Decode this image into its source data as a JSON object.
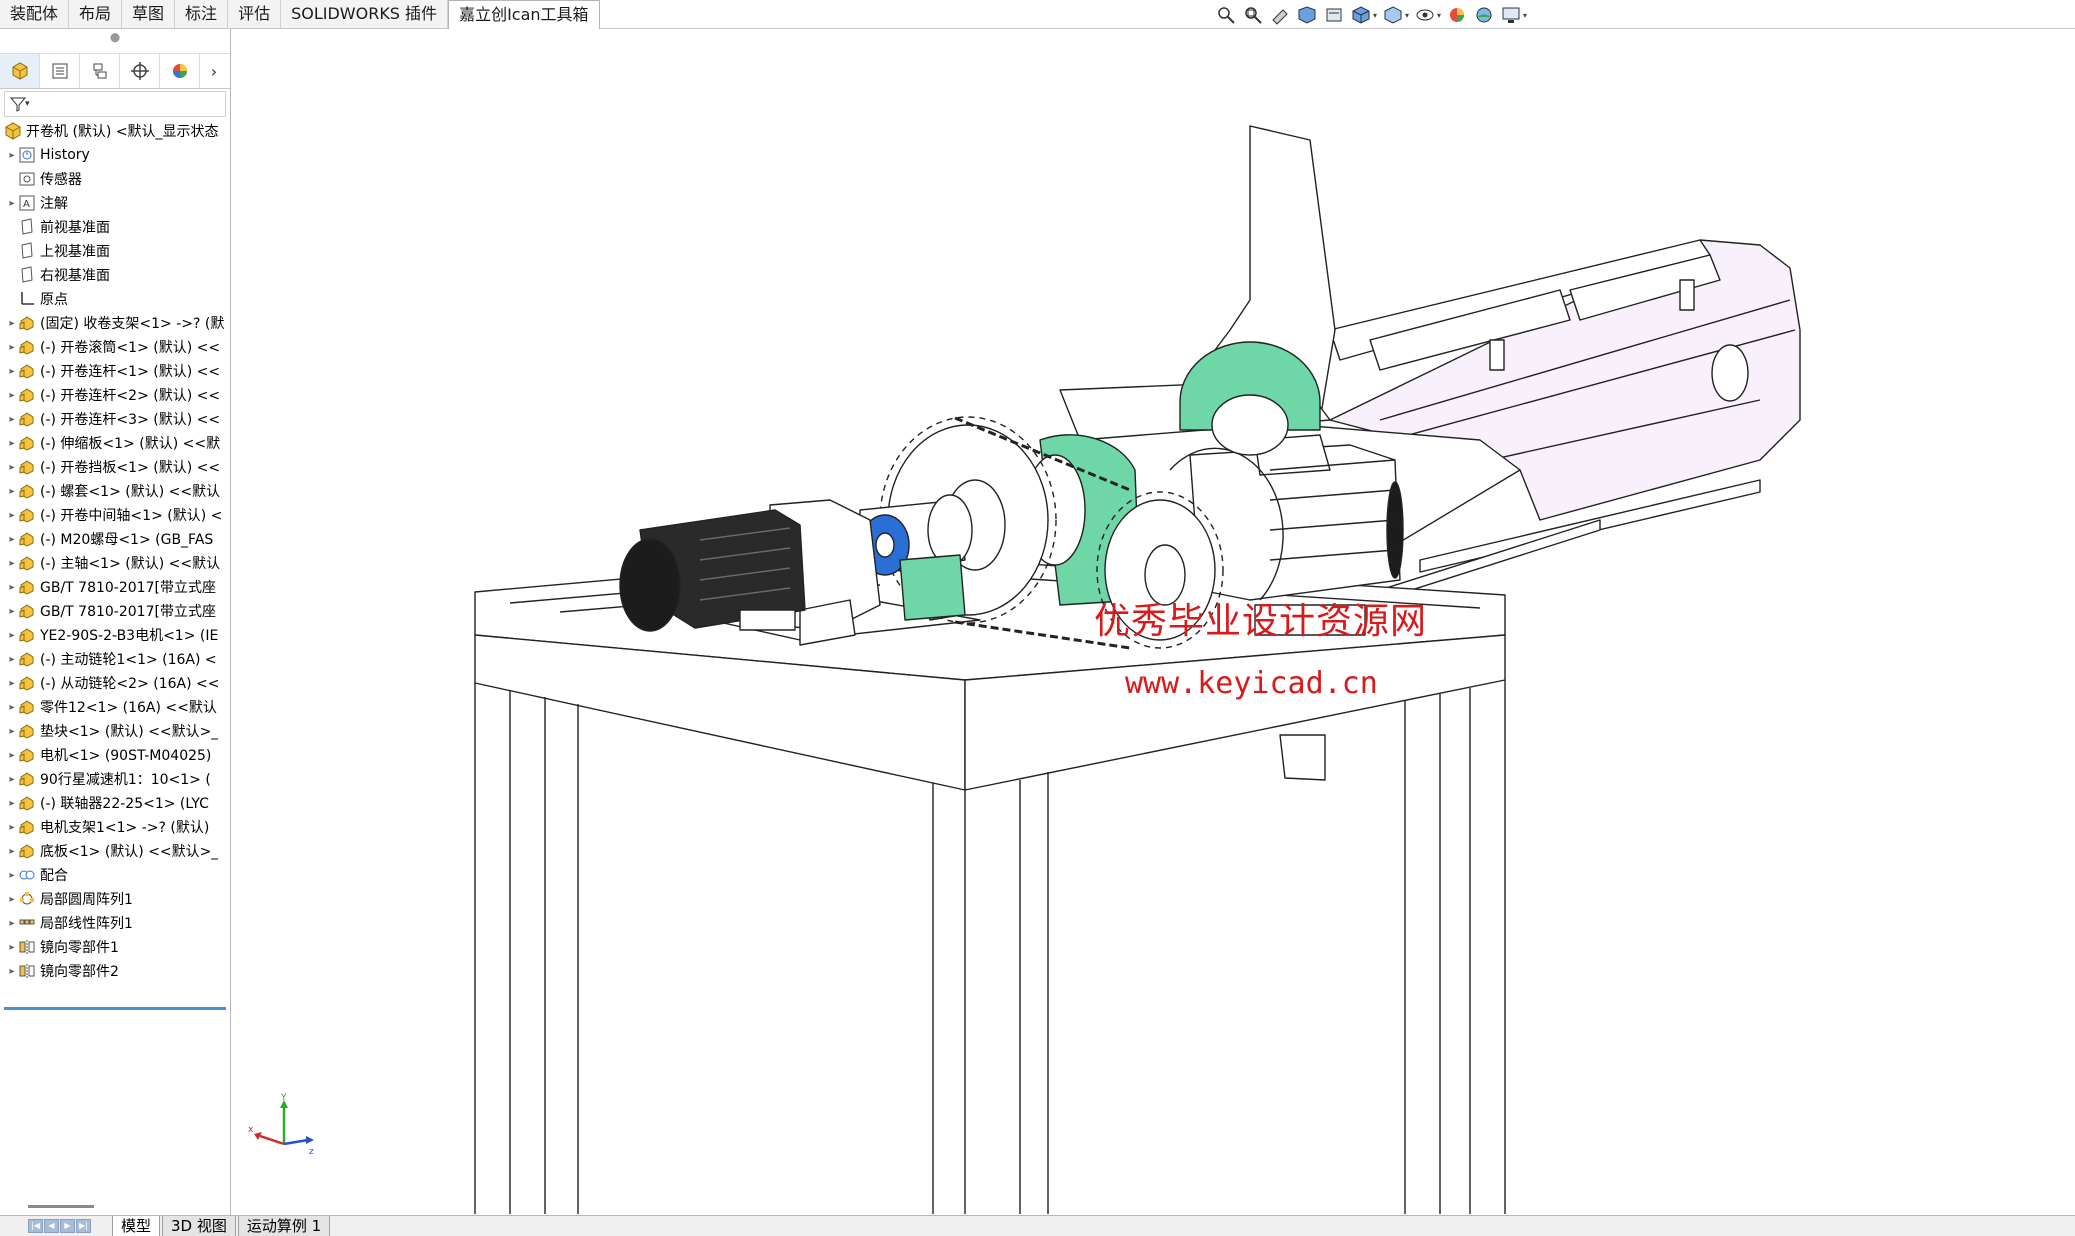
{
  "ribbon": {
    "tabs": [
      {
        "label": "装配体",
        "active": false
      },
      {
        "label": "布局",
        "active": false
      },
      {
        "label": "草图",
        "active": false
      },
      {
        "label": "标注",
        "active": false
      },
      {
        "label": "评估",
        "active": false
      },
      {
        "label": "SOLIDWORKS 插件",
        "active": false
      },
      {
        "label": "嘉立创Ican工具箱",
        "active": true
      }
    ],
    "headsup_icons": [
      "zoom-to-fit-icon",
      "zoom-area-icon",
      "previous-view-icon",
      "section-view-icon",
      "dynamic-annotation-icon",
      "view-orientation-icon",
      "display-style-icon",
      "hide-show-icon",
      "edit-appearance-icon",
      "apply-scene-icon",
      "view-settings-icon"
    ]
  },
  "feature_tree": {
    "root": "开卷机 (默认) <默认_显示状态",
    "items": [
      {
        "label": "History",
        "icon": "history-icon",
        "expandable": true
      },
      {
        "label": "传感器",
        "icon": "sensor-icon",
        "expandable": false
      },
      {
        "label": "注解",
        "icon": "annotation-icon",
        "expandable": true
      },
      {
        "label": "前视基准面",
        "icon": "plane-icon",
        "expandable": false
      },
      {
        "label": "上视基准面",
        "icon": "plane-icon",
        "expandable": false
      },
      {
        "label": "右视基准面",
        "icon": "plane-icon",
        "expandable": false
      },
      {
        "label": "原点",
        "icon": "origin-icon",
        "expandable": false
      },
      {
        "label": "(固定) 收卷支架<1> ->? (默",
        "icon": "part-icon",
        "expandable": true
      },
      {
        "label": "(-) 开卷滚筒<1> (默认) <<",
        "icon": "part-icon",
        "expandable": true
      },
      {
        "label": "(-) 开卷连杆<1> (默认) <<",
        "icon": "part-icon",
        "expandable": true
      },
      {
        "label": "(-) 开卷连杆<2> (默认) <<",
        "icon": "part-icon",
        "expandable": true
      },
      {
        "label": "(-) 开卷连杆<3> (默认) <<",
        "icon": "part-icon",
        "expandable": true
      },
      {
        "label": "(-) 伸缩板<1> (默认) <<默",
        "icon": "part-icon",
        "expandable": true
      },
      {
        "label": "(-) 开卷挡板<1> (默认) <<",
        "icon": "part-icon",
        "expandable": true
      },
      {
        "label": "(-) 螺套<1> (默认) <<默认",
        "icon": "part-icon",
        "expandable": true
      },
      {
        "label": "(-) 开卷中间轴<1> (默认) <",
        "icon": "part-icon",
        "expandable": true
      },
      {
        "label": "(-) M20螺母<1> (GB_FAS",
        "icon": "part-icon",
        "expandable": true
      },
      {
        "label": "(-) 主轴<1> (默认) <<默认",
        "icon": "part-icon",
        "expandable": true
      },
      {
        "label": "GB/T 7810-2017[带立式座",
        "icon": "part-icon",
        "expandable": true
      },
      {
        "label": "GB/T 7810-2017[带立式座",
        "icon": "part-icon",
        "expandable": true
      },
      {
        "label": "YE2-90S-2-B3电机<1> (IE",
        "icon": "part-icon",
        "expandable": true
      },
      {
        "label": "(-) 主动链轮1<1> (16A) <",
        "icon": "part-icon",
        "expandable": true
      },
      {
        "label": "(-) 从动链轮<2> (16A) <<",
        "icon": "part-icon",
        "expandable": true
      },
      {
        "label": "零件12<1> (16A) <<默认",
        "icon": "part-icon",
        "expandable": true
      },
      {
        "label": "垫块<1> (默认) <<默认>_",
        "icon": "part-icon",
        "expandable": true
      },
      {
        "label": "电机<1> (90ST-M04025)",
        "icon": "part-icon",
        "expandable": true
      },
      {
        "label": "90行星减速机1：10<1> (",
        "icon": "part-icon",
        "expandable": true
      },
      {
        "label": "(-) 联轴器22-25<1> (LYC",
        "icon": "part-icon",
        "expandable": true
      },
      {
        "label": "电机支架1<1> ->? (默认)",
        "icon": "part-icon",
        "expandable": true
      },
      {
        "label": "底板<1> (默认) <<默认>_",
        "icon": "part-icon",
        "expandable": true
      },
      {
        "label": "配合",
        "icon": "mates-icon",
        "expandable": true
      },
      {
        "label": "局部圆周阵列1",
        "icon": "circular-pattern-icon",
        "expandable": true
      },
      {
        "label": "局部线性阵列1",
        "icon": "linear-pattern-icon",
        "expandable": true
      },
      {
        "label": "镜向零部件1",
        "icon": "mirror-icon",
        "expandable": true
      },
      {
        "label": "镜向零部件2",
        "icon": "mirror-icon",
        "expandable": true
      }
    ]
  },
  "bottom_tabs": [
    {
      "label": "模型",
      "active": true
    },
    {
      "label": "3D 视图",
      "active": false
    },
    {
      "label": "运动算例 1",
      "active": false
    }
  ],
  "viewport": {
    "watermark_text": "优秀毕业设计资源网",
    "watermark_url": "www.keyicad.cn",
    "watermark_color": "#d81a1a",
    "triad_labels": {
      "x": "x",
      "y": "Y",
      "z": "z"
    }
  },
  "colors": {
    "accent": "#4a90d9",
    "bearing_green": "#6fd6a8",
    "motor_black": "#1c1c1c",
    "coupling_blue": "#2a6fd6",
    "roller_pink": "#f3e8f7"
  }
}
